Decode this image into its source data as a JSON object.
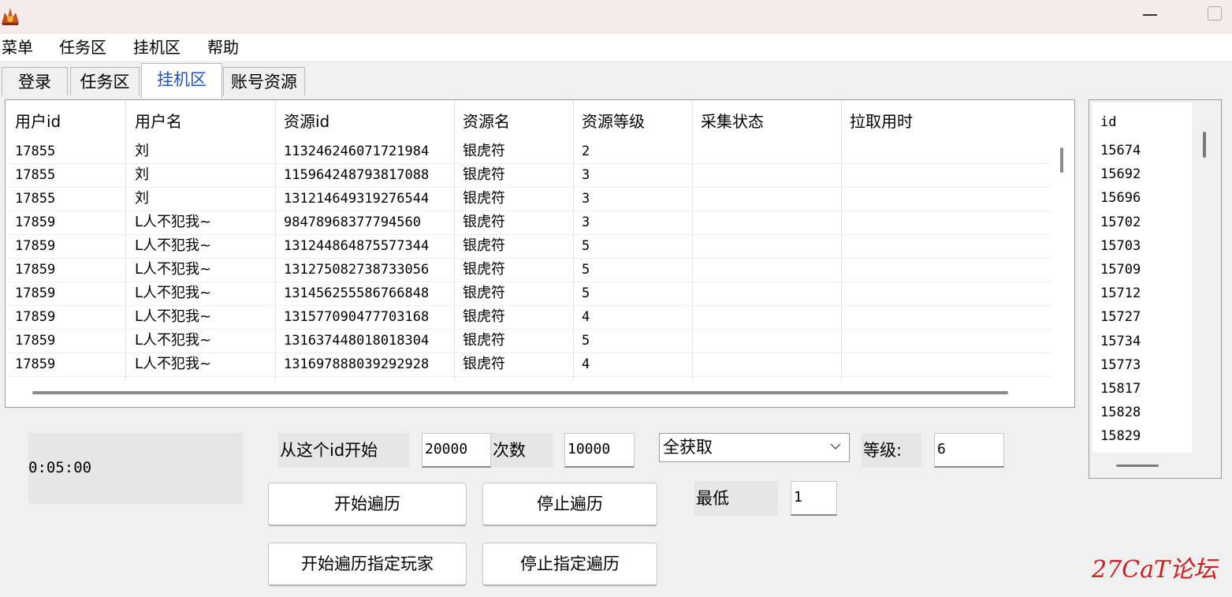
{
  "menu": [
    "菜单",
    "任务区",
    "挂机区",
    "帮助"
  ],
  "tabs": [
    "登录",
    "任务区",
    "挂机区",
    "账号资源"
  ],
  "table": {
    "headers": [
      "用户id",
      "用户名",
      "资源id",
      "资源名",
      "资源等级",
      "采集状态",
      "拉取用时"
    ],
    "rows": [
      [
        "17855",
        "刘",
        "113246246071721984",
        "银虎符",
        "2",
        "",
        ""
      ],
      [
        "17855",
        "刘",
        "115964248793817088",
        "银虎符",
        "3",
        "",
        ""
      ],
      [
        "17855",
        "刘",
        "131214649319276544",
        "银虎符",
        "3",
        "",
        ""
      ],
      [
        "17859",
        "L人不犯我~",
        "98478968377794560",
        "银虎符",
        "3",
        "",
        ""
      ],
      [
        "17859",
        "L人不犯我~",
        "131244864875577344",
        "银虎符",
        "5",
        "",
        ""
      ],
      [
        "17859",
        "L人不犯我~",
        "131275082738733056",
        "银虎符",
        "5",
        "",
        ""
      ],
      [
        "17859",
        "L人不犯我~",
        "131456255586766848",
        "银虎符",
        "5",
        "",
        ""
      ],
      [
        "17859",
        "L人不犯我~",
        "131577090477703168",
        "银虎符",
        "4",
        "",
        ""
      ],
      [
        "17859",
        "L人不犯我~",
        "131637448018018304",
        "银虎符",
        "5",
        "",
        ""
      ],
      [
        "17859",
        "L人不犯我~",
        "131697888039292928",
        "银虎符",
        "4",
        "",
        ""
      ]
    ]
  },
  "side_list": {
    "header": "id",
    "items": [
      "15674",
      "15692",
      "15696",
      "15702",
      "15703",
      "15709",
      "15712",
      "15727",
      "15734",
      "15773",
      "15817",
      "15828",
      "15829"
    ]
  },
  "controls": {
    "timer": "0:05:00",
    "start_id_label": "从这个id开始",
    "start_id_value": "20000",
    "count_label": "次数",
    "count_value": "10000",
    "mode_value": "全获取",
    "level_label": "等级:",
    "level_value": "6",
    "min_label": "最低",
    "min_value": "1",
    "start_traverse": "开始遍历",
    "stop_traverse": "停止遍历",
    "start_player_traverse": "开始遍历指定玩家",
    "stop_player_traverse": "停止指定遍历"
  },
  "watermark": "27CaT论坛"
}
